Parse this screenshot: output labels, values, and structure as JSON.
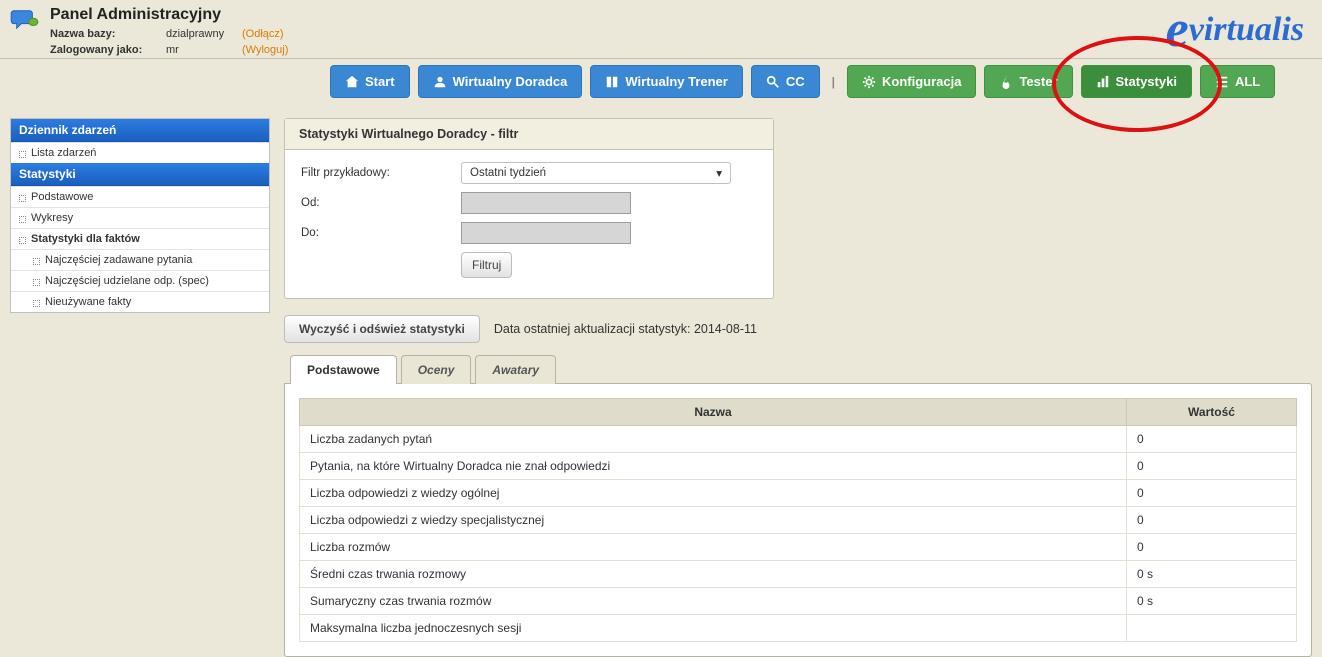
{
  "header": {
    "title": "Panel Administracyjny",
    "db_label": "Nazwa bazy:",
    "db_value": "dzialprawny",
    "disconnect": "(Odłącz)",
    "user_label": "Zalogowany jako:",
    "user_value": "mr",
    "logout": "(Wyloguj)",
    "logo_prefix": "e",
    "logo_rest": "virtualis"
  },
  "nav": {
    "start": "Start",
    "wd": "Wirtualny Doradca",
    "trener": "Wirtualny Trener",
    "cc": "CC",
    "config": "Konfiguracja",
    "tester": "Tester",
    "stats": "Statystyki",
    "all": "ALL"
  },
  "sidebar": {
    "log_head": "Dziennik zdarzeń",
    "log_item": "Lista zdarzeń",
    "stats_head": "Statystyki",
    "items": {
      "basic": "Podstawowe",
      "charts": "Wykresy",
      "facts": "Statystyki dla faktów",
      "faq": "Najczęściej zadawane pytania",
      "spec": "Najczęściej udzielane odp. (spec)",
      "unused": "Nieużywane fakty"
    }
  },
  "filter": {
    "panel_title": "Statystyki Wirtualnego Doradcy - filtr",
    "example_lbl": "Filtr przykładowy:",
    "example_val": "Ostatni tydzień",
    "from_lbl": "Od:",
    "to_lbl": "Do:",
    "submit": "Filtruj"
  },
  "refresh": {
    "btn": "Wyczyść i odśwież statystyki",
    "text": "Data ostatniej aktualizacji statystyk: 2014-08-11"
  },
  "tabs": {
    "basic": "Podstawowe",
    "ratings": "Oceny",
    "avatars": "Awatary"
  },
  "table": {
    "col_name": "Nazwa",
    "col_value": "Wartość",
    "rows": [
      {
        "name": "Liczba zadanych pytań",
        "value": "0"
      },
      {
        "name": "Pytania, na które Wirtualny Doradca nie znał odpowiedzi",
        "value": "0"
      },
      {
        "name": "Liczba odpowiedzi z wiedzy ogólnej",
        "value": "0"
      },
      {
        "name": "Liczba odpowiedzi z wiedzy specjalistycznej",
        "value": "0"
      },
      {
        "name": "Liczba rozmów",
        "value": "0"
      },
      {
        "name": "Średni czas trwania rozmowy",
        "value": "0 s"
      },
      {
        "name": "Sumaryczny czas trwania rozmów",
        "value": "0 s"
      },
      {
        "name": "Maksymalna liczba jednoczesnych sesji",
        "value": ""
      }
    ]
  }
}
